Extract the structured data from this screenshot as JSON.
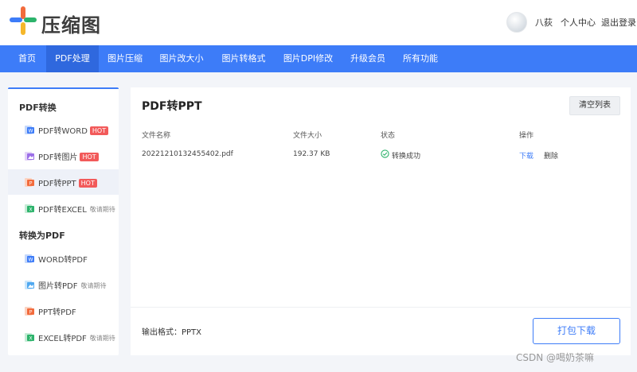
{
  "header": {
    "brand": "压缩图",
    "user_name": "八荻",
    "personal_center": "个人中心",
    "logout": "退出登录",
    "logo_colors": [
      "#f26b3c",
      "#3d7cf8",
      "#2cb36b",
      "#f5b72b"
    ]
  },
  "nav": {
    "items": [
      {
        "label": "首页"
      },
      {
        "label": "PDF处理",
        "active": true
      },
      {
        "label": "图片压缩"
      },
      {
        "label": "图片改大小"
      },
      {
        "label": "图片转格式"
      },
      {
        "label": "图片DPI修改"
      },
      {
        "label": "升级会员"
      },
      {
        "label": "所有功能"
      }
    ]
  },
  "sidebar": {
    "section1": "PDF转换",
    "section2": "转换为PDF",
    "items": [
      {
        "label": "PDF转WORD",
        "badge": "HOT",
        "icon": "word-icon"
      },
      {
        "label": "PDF转图片",
        "badge": "HOT",
        "icon": "image-icon"
      },
      {
        "label": "PDF转PPT",
        "badge": "HOT",
        "icon": "ppt-icon",
        "active": true
      },
      {
        "label": "PDF转EXCEL",
        "badge": "敬请期待",
        "icon": "excel-icon"
      },
      {
        "label": "WORD转PDF",
        "icon": "word-icon"
      },
      {
        "label": "图片转PDF",
        "badge": "敬请期待",
        "icon": "image-icon"
      },
      {
        "label": "PPT转PDF",
        "icon": "ppt-icon"
      },
      {
        "label": "EXCEL转PDF",
        "badge": "敬请期待",
        "icon": "excel-icon"
      }
    ]
  },
  "main": {
    "title": "PDF转PPT",
    "clear_button": "清空列表",
    "columns": {
      "name": "文件名称",
      "size": "文件大小",
      "status": "状态",
      "action": "操作"
    },
    "rows": [
      {
        "name": "20221210132455402.pdf",
        "size": "192.37 KB",
        "status": "转换成功",
        "download": "下载",
        "delete": "删除"
      }
    ],
    "output_format": "输出格式：PPTX",
    "download_button": "打包下载"
  },
  "watermark": "CSDN @喝奶茶嘛",
  "colors": {
    "accent": "#3d7cf8",
    "hot_badge": "#f25a5a",
    "success": "#2cb36b"
  }
}
